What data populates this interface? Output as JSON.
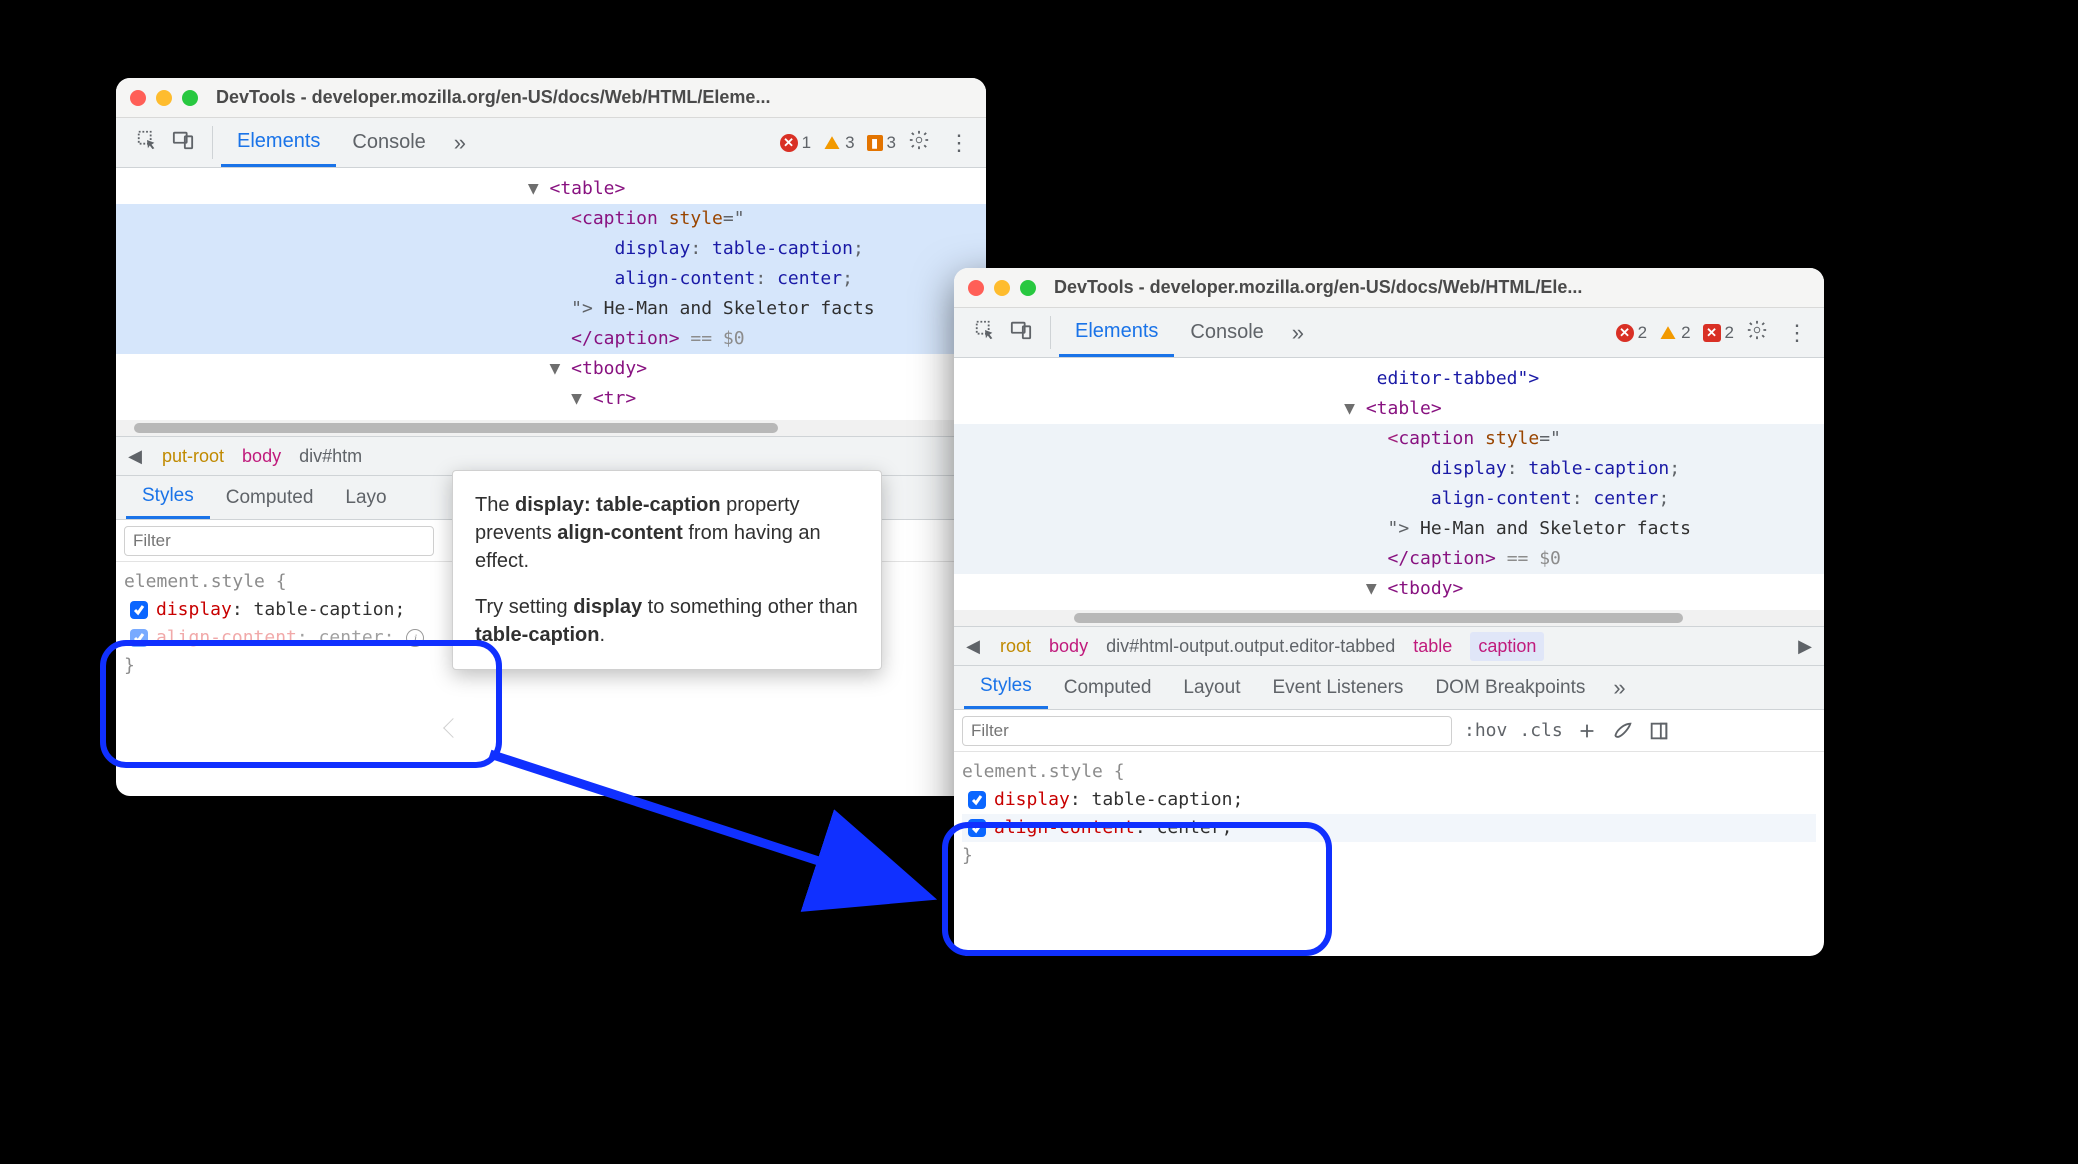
{
  "window1": {
    "title": "DevTools - developer.mozilla.org/en-US/docs/Web/HTML/Eleme...",
    "tabs": {
      "elements": "Elements",
      "console": "Console"
    },
    "counts": {
      "errors": "1",
      "warnings": "3",
      "flags": "3"
    },
    "dom": {
      "table_open": "<table>",
      "caption_open": "<caption",
      "style_attr": "style",
      "style_open_quote": "=\"",
      "css_display_name": "display",
      "css_display_val": "table-caption",
      "css_align_name": "align-content",
      "css_align_val": "center",
      "caption_close_quote": "\">",
      "caption_text": " He-Man and Skeletor facts",
      "caption_close": "</caption>",
      "selected_marker": " == $0",
      "tbody_open": "<tbody>",
      "tr_open": "<tr>"
    },
    "crumbs": {
      "first": "put-root",
      "body": "body",
      "div": "div#htm"
    },
    "subtabs": {
      "styles": "Styles",
      "computed": "Computed",
      "layout": "Layo"
    },
    "filter_placeholder": "Filter",
    "styles": {
      "selector": "element.style {",
      "display_name": "display",
      "display_val": "table-caption",
      "align_name": "align-content",
      "align_val": "center",
      "brace_close": "}"
    }
  },
  "tooltip": {
    "line1_pre": "The ",
    "line1_b1": "display: table-caption",
    "line1_mid": " property prevents ",
    "line1_b2": "align-content",
    "line1_post": " from having an effect.",
    "line2_pre": "Try setting ",
    "line2_b1": "display",
    "line2_mid": " to something other than ",
    "line2_b2": "table-caption",
    "line2_post": "."
  },
  "window2": {
    "title": "DevTools - developer.mozilla.org/en-US/docs/Web/HTML/Ele...",
    "tabs": {
      "elements": "Elements",
      "console": "Console"
    },
    "counts": {
      "errors": "2",
      "warnings": "2",
      "err_sq": "2"
    },
    "dom": {
      "tail_text": "editor-tabbed\">",
      "table_open": "<table>",
      "caption_open": "<caption",
      "style_attr": "style",
      "style_open_quote": "=\"",
      "css_display_name": "display",
      "css_display_val": "table-caption",
      "css_align_name": "align-content",
      "css_align_val": "center",
      "caption_close_quote": "\">",
      "caption_text": " He-Man and Skeletor facts",
      "caption_close": "</caption>",
      "selected_marker": " == $0",
      "tbody_open": "<tbody>"
    },
    "crumbs": {
      "root": "root",
      "body": "body",
      "div": "div#html-output.output.editor-tabbed",
      "table": "table",
      "caption": "caption"
    },
    "subtabs": {
      "styles": "Styles",
      "computed": "Computed",
      "layout": "Layout",
      "events": "Event Listeners",
      "dom_bp": "DOM Breakpoints"
    },
    "filter_placeholder": "Filter",
    "filterbar": {
      "hov": ":hov",
      "cls": ".cls"
    },
    "styles": {
      "selector": "element.style {",
      "display_name": "display",
      "display_val": "table-caption",
      "align_name": "align-content",
      "align_val": "center",
      "brace_close": "}"
    }
  }
}
